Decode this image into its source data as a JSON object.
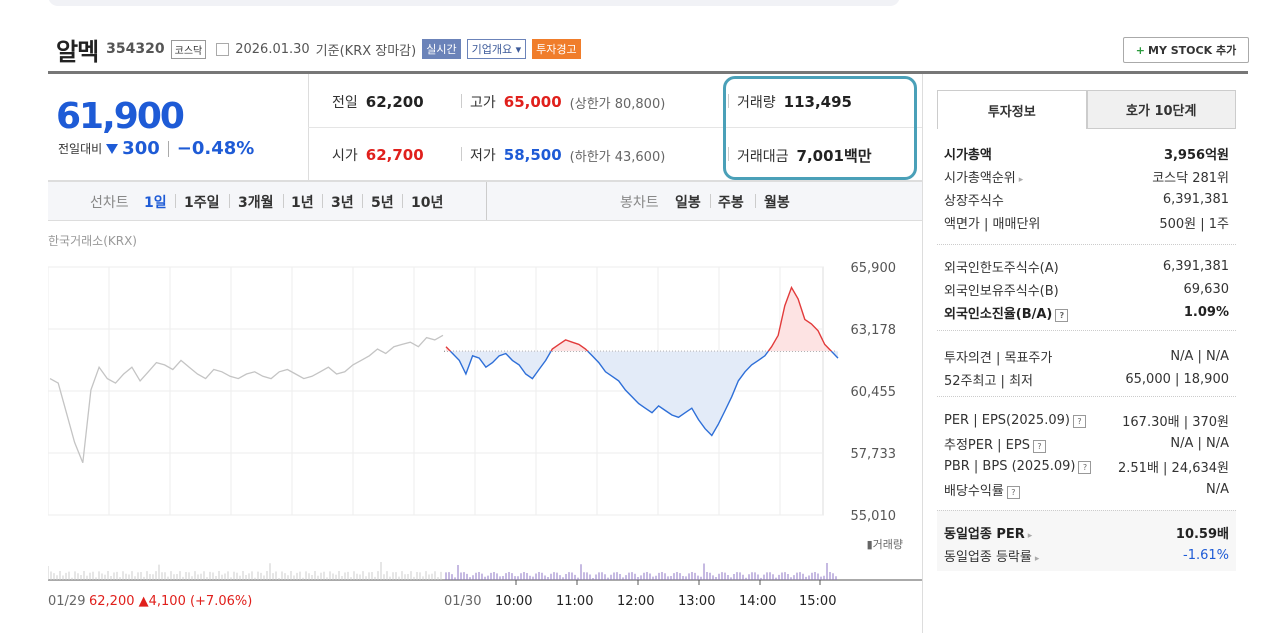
{
  "header": {
    "stock_name": "알멕",
    "code": "354320",
    "market": "코스닥",
    "date": "2026.01.30",
    "basis": "기준(KRX 장마감)",
    "realtime": "실시간",
    "company_info": "기업개요",
    "warning": "투자경고",
    "mystock_label": "MY STOCK 추가"
  },
  "price": {
    "current": "61,900",
    "prev_label": "전일대비",
    "change": "300",
    "change_pct": "−0.48%"
  },
  "info": {
    "prev_close_label": "전일",
    "prev_close": "62,200",
    "high_label": "고가",
    "high": "65,000",
    "upper_limit": "(상한가 80,800)",
    "volume_label": "거래량",
    "volume": "113,495",
    "open_label": "시가",
    "open": "62,700",
    "low_label": "저가",
    "low": "58,500",
    "lower_limit": "(하한가 43,600)",
    "amount_label": "거래대금",
    "amount": "7,001",
    "amount_unit": "백만"
  },
  "periods": {
    "line_label": "선차트",
    "line_items": [
      "1일",
      "1주일",
      "3개월",
      "1년",
      "3년",
      "5년",
      "10년"
    ],
    "candle_label": "봉차트",
    "candle_items": [
      "일봉",
      "주봉",
      "월봉"
    ]
  },
  "chart_data": {
    "type": "line",
    "source": "한국거래소(KRX)",
    "y_ticks": [
      "65,900",
      "63,178",
      "60,455",
      "57,733",
      "55,010"
    ],
    "ylim": [
      55010,
      65900
    ],
    "prev_close": 62200,
    "volume_label": "거래량",
    "x_ticks": [
      "01/29",
      "01/30",
      "10:00",
      "11:00",
      "12:00",
      "13:00",
      "14:00",
      "15:00"
    ],
    "prev_day_summary": {
      "price": "62,200",
      "change": "▲4,100",
      "pct": "(+7.06%)"
    },
    "prev_day_series": [
      61000,
      60800,
      59500,
      58200,
      57300,
      60500,
      61500,
      61000,
      60800,
      61200,
      61500,
      60900,
      61300,
      61700,
      61600,
      61400,
      61800,
      61500,
      61200,
      61000,
      61400,
      61300,
      61100,
      61000,
      61200,
      61300,
      61100,
      61000,
      61300,
      61400,
      61200,
      61000,
      61100,
      61300,
      61500,
      61200,
      61300,
      61600,
      61800,
      62000,
      62300,
      62100,
      62400,
      62500,
      62600,
      62400,
      62800,
      62700,
      62900
    ],
    "today_series": [
      62400,
      62100,
      61800,
      61200,
      62000,
      61900,
      61500,
      61700,
      62000,
      62100,
      61800,
      61600,
      61200,
      61000,
      61400,
      61800,
      62300,
      62500,
      62700,
      62600,
      62500,
      62300,
      62000,
      61700,
      61300,
      61100,
      60900,
      60500,
      60200,
      59900,
      59700,
      59500,
      59800,
      59600,
      59400,
      59300,
      59500,
      59700,
      59200,
      58800,
      58500,
      59000,
      59600,
      60200,
      60900,
      61300,
      61600,
      61800,
      62000,
      62400,
      62900,
      64200,
      65000,
      64500,
      63600,
      63400,
      63100,
      62500,
      62200,
      61900
    ]
  },
  "right_panel": {
    "tabs": [
      "투자정보",
      "호가 10단계"
    ],
    "sec1": [
      {
        "label": "시가총액",
        "value": "3,956억원"
      },
      {
        "label": "시가총액순위",
        "value": "코스닥 281위"
      },
      {
        "label": "상장주식수",
        "value": "6,391,381"
      },
      {
        "label": "액면가 | 매매단위",
        "value": "500원 | 1주"
      }
    ],
    "sec2": [
      {
        "label": "외국인한도주식수(A)",
        "value": "6,391,381"
      },
      {
        "label": "외국인보유주식수(B)",
        "value": "69,630"
      },
      {
        "label": "외국인소진율(B/A)",
        "value": "1.09%"
      }
    ],
    "sec3": [
      {
        "label": "투자의견 | 목표주가",
        "value": "N/A | N/A"
      },
      {
        "label": "52주최고 | 최저",
        "value": "65,000 | 18,900"
      }
    ],
    "sec4": [
      {
        "label": "PER | EPS(2025.09)",
        "value": "167.30배 | 370원"
      },
      {
        "label": "추정PER | EPS",
        "value": "N/A | N/A"
      },
      {
        "label": "PBR | BPS (2025.09)",
        "value": "2.51배 | 24,634원"
      },
      {
        "label": "배당수익률",
        "value": "N/A"
      }
    ],
    "sec5": [
      {
        "label": "동일업종 PER",
        "value": "10.59배"
      },
      {
        "label": "동일업종 등락률",
        "value": "-1.61%"
      }
    ]
  }
}
